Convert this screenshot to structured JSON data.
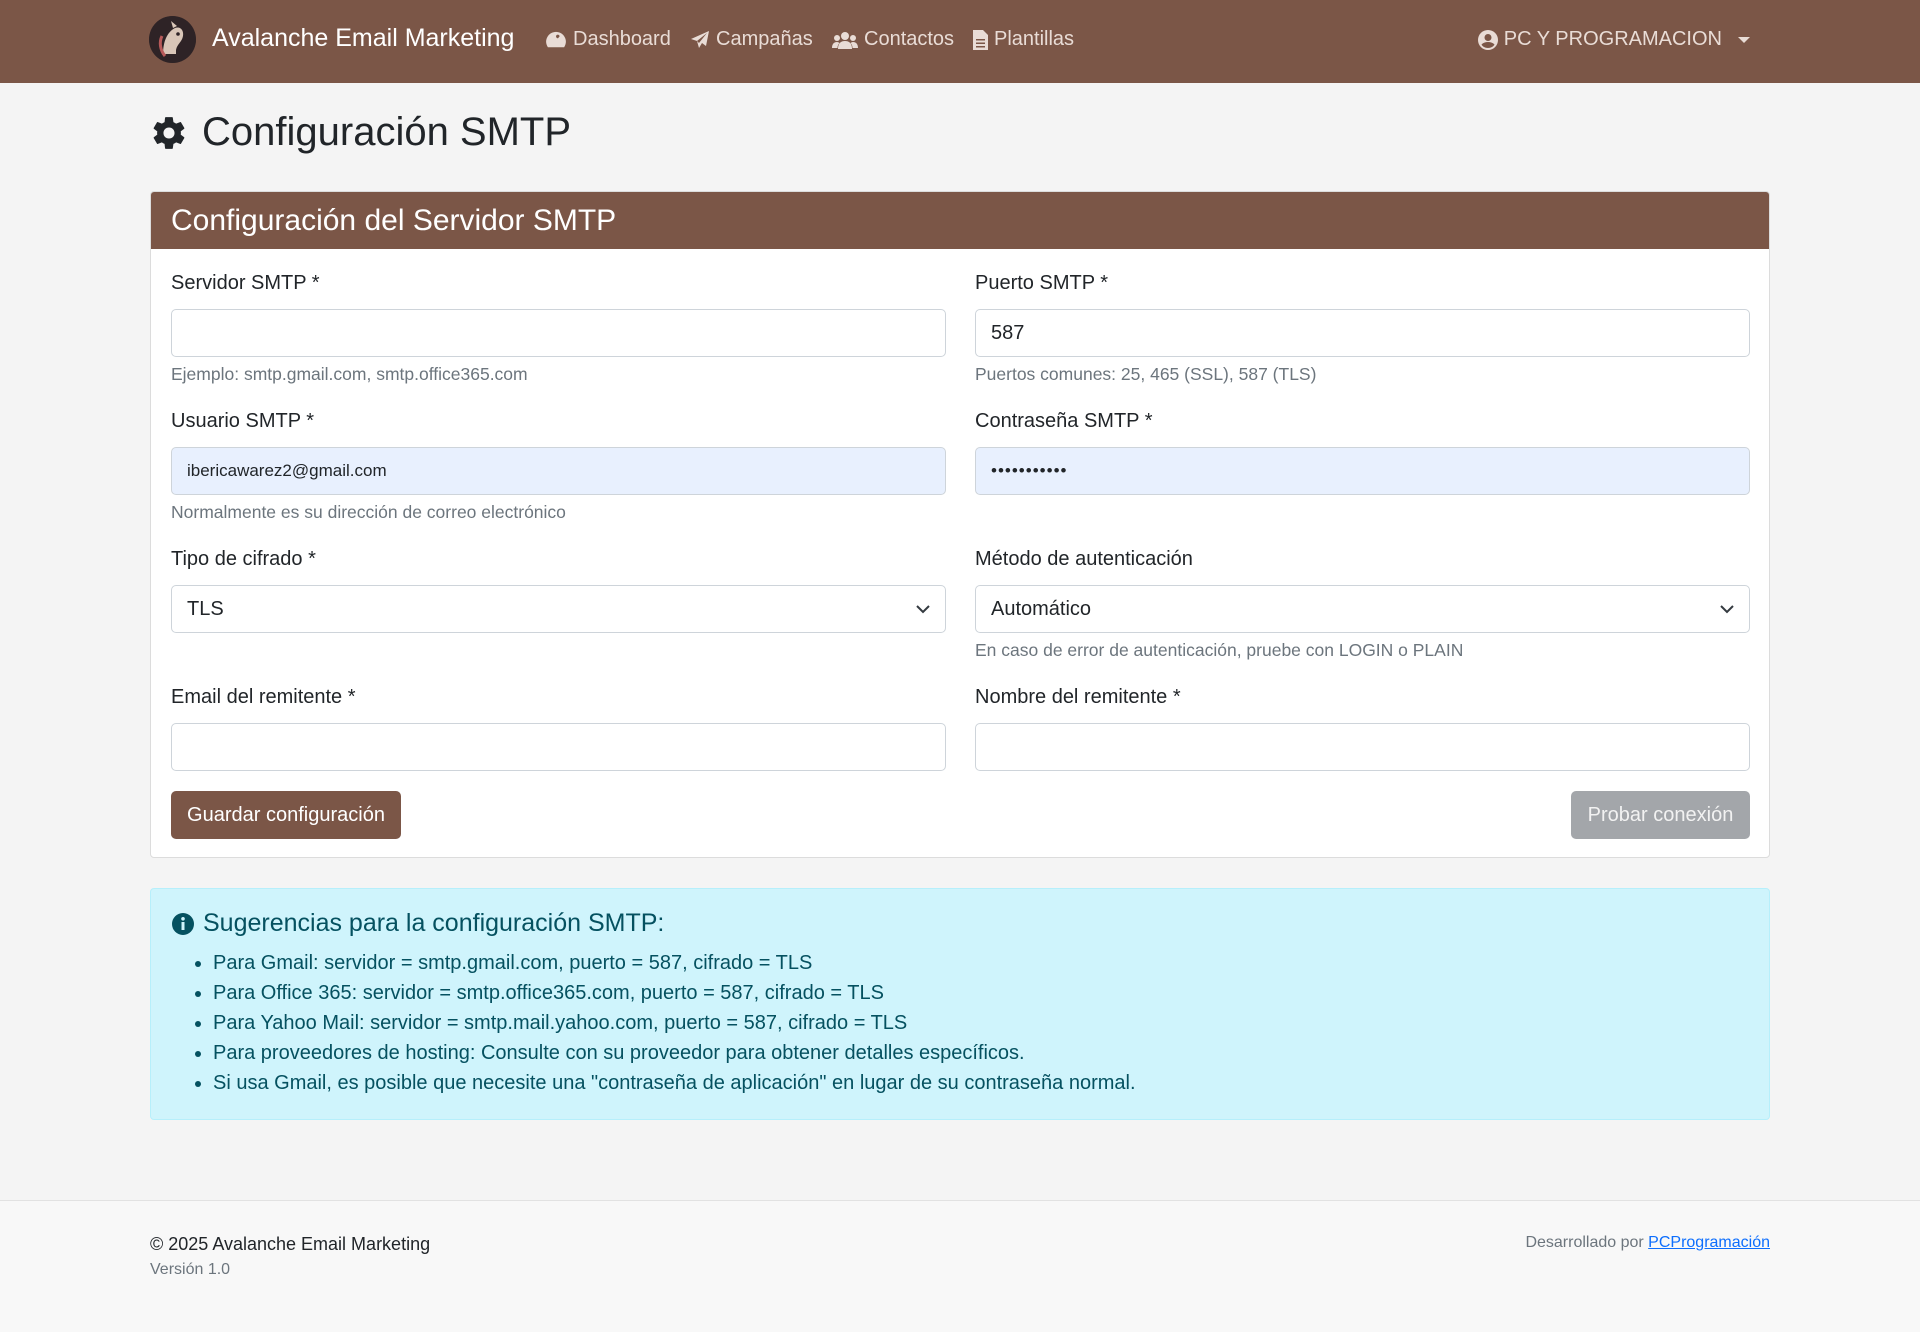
{
  "navbar": {
    "brand": "Avalanche Email Marketing",
    "links": [
      {
        "label": "Dashboard",
        "icon": "tachometer-icon"
      },
      {
        "label": "Campañas",
        "icon": "paper-plane-icon"
      },
      {
        "label": "Contactos",
        "icon": "users-icon"
      },
      {
        "label": "Plantillas",
        "icon": "file-icon"
      }
    ],
    "user": "PC Y PROGRAMACION"
  },
  "page": {
    "title": "Configuración SMTP"
  },
  "card": {
    "header": "Configuración del Servidor SMTP",
    "fields": {
      "server": {
        "label": "Servidor SMTP *",
        "value": "",
        "help": "Ejemplo: smtp.gmail.com, smtp.office365.com"
      },
      "port": {
        "label": "Puerto SMTP *",
        "value": "587",
        "help": "Puertos comunes: 25, 465 (SSL), 587 (TLS)"
      },
      "user": {
        "label": "Usuario SMTP *",
        "value": "ibericawarez2@gmail.com",
        "help": "Normalmente es su dirección de correo electrónico"
      },
      "password": {
        "label": "Contraseña SMTP *",
        "value": "•••••••••••"
      },
      "encryption": {
        "label": "Tipo de cifrado *",
        "value": "TLS"
      },
      "auth": {
        "label": "Método de autenticación",
        "value": "Automático",
        "help": "En caso de error de autenticación, pruebe con LOGIN o PLAIN"
      },
      "sender_email": {
        "label": "Email del remitente *",
        "value": ""
      },
      "sender_name": {
        "label": "Nombre del remitente *",
        "value": ""
      }
    },
    "save_label": "Guardar configuración",
    "test_label": "Probar conexión"
  },
  "tips": {
    "title": "Sugerencias para la configuración SMTP:",
    "items": [
      "Para Gmail: servidor = smtp.gmail.com, puerto = 587, cifrado = TLS",
      "Para Office 365: servidor = smtp.office365.com, puerto = 587, cifrado = TLS",
      "Para Yahoo Mail: servidor = smtp.mail.yahoo.com, puerto = 587, cifrado = TLS",
      "Para proveedores de hosting: Consulte con su proveedor para obtener detalles específicos.",
      "Si usa Gmail, es posible que necesite una \"contraseña de aplicación\" en lugar de su contraseña normal."
    ]
  },
  "footer": {
    "copyright": "© 2025 Avalanche Email Marketing",
    "version": "Versión 1.0",
    "developed_by": "Desarrollado por",
    "developer_link": "PCProgramación"
  },
  "colors": {
    "primary": "#7b5647",
    "info_bg": "#cff4fc",
    "info_text": "#055160",
    "autofill_bg": "#e8f0fe",
    "secondary_btn": "#a3a6aa"
  }
}
